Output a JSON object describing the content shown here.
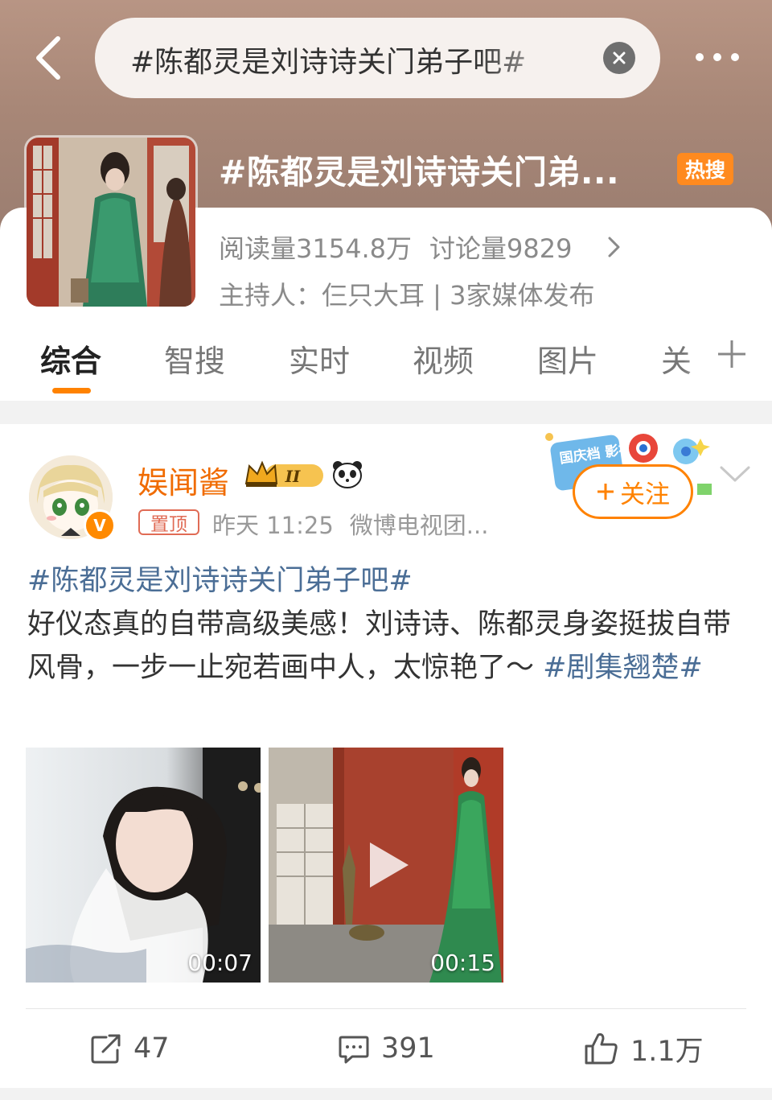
{
  "topbar": {
    "search_text": "#陈都灵是刘诗诗关门弟子吧#"
  },
  "topic": {
    "title": "#陈都灵是刘诗诗关门弟...",
    "hot_badge": "热搜",
    "reads": "阅读量3154.8万",
    "discussions": "讨论量9829",
    "host": "主持人：仨只大耳 | 3家媒体发布"
  },
  "tabs": [
    "综合",
    "智搜",
    "实时",
    "视频",
    "图片",
    "关"
  ],
  "post": {
    "author": "娱闻酱",
    "pin_label": "置顶",
    "time": "昨天 11:25",
    "source": "微博电视团...",
    "follow_label": "关注",
    "hashtag_top": "#陈都灵是刘诗诗关门弟子吧#",
    "text": "好仪态真的自带高级美感！刘诗诗、陈都灵身姿挺拔自带风骨，一步一止宛若画中人，太惊艳了～ ",
    "hashtag_end": "#剧集翘楚#",
    "promo_text": "国庆档 影视",
    "videos": [
      {
        "duration": "00:07"
      },
      {
        "duration": "00:15"
      }
    ],
    "actions": {
      "share": "47",
      "comments": "391",
      "likes": "1.1万"
    }
  },
  "colors": {
    "accent": "#ff8200",
    "hashtag": "#4b6e96",
    "header_bg": "#a88777"
  }
}
